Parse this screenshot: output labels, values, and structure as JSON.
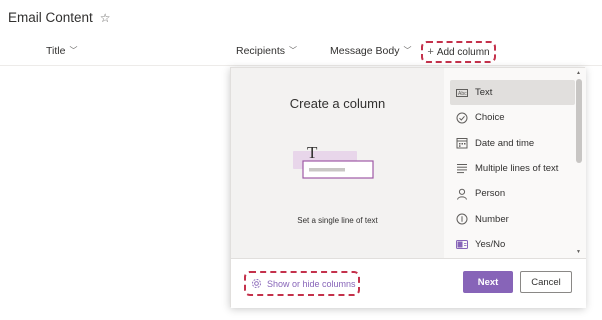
{
  "page": {
    "title": "Email Content",
    "favorite_icon": "star-outline-icon"
  },
  "columns": {
    "title": "Title",
    "recipients": "Recipients",
    "message_body": "Message Body",
    "add_column": "Add column",
    "chevron_icon": "chevron-down-icon",
    "add_icon": "plus-icon"
  },
  "create_panel": {
    "heading": "Create a column",
    "illustration_help": "Set a single line of text",
    "illustration_glyph": "T",
    "column_types": [
      {
        "label": "Text",
        "icon": "text-field-icon",
        "selected": true
      },
      {
        "label": "Choice",
        "icon": "choice-check-icon",
        "selected": false
      },
      {
        "label": "Date and time",
        "icon": "calendar-icon",
        "selected": false
      },
      {
        "label": "Multiple lines of text",
        "icon": "multiline-text-icon",
        "selected": false
      },
      {
        "label": "Person",
        "icon": "person-icon",
        "selected": false
      },
      {
        "label": "Number",
        "icon": "number-icon",
        "selected": false
      },
      {
        "label": "Yes/No",
        "icon": "toggle-icon",
        "selected": false
      }
    ],
    "show_hide_columns": "Show or hide columns",
    "next_label": "Next",
    "cancel_label": "Cancel"
  },
  "colors": {
    "accent": "#8764b8",
    "highlight_dashed": "#c4314b",
    "selected_bg": "#e1dfdd"
  }
}
